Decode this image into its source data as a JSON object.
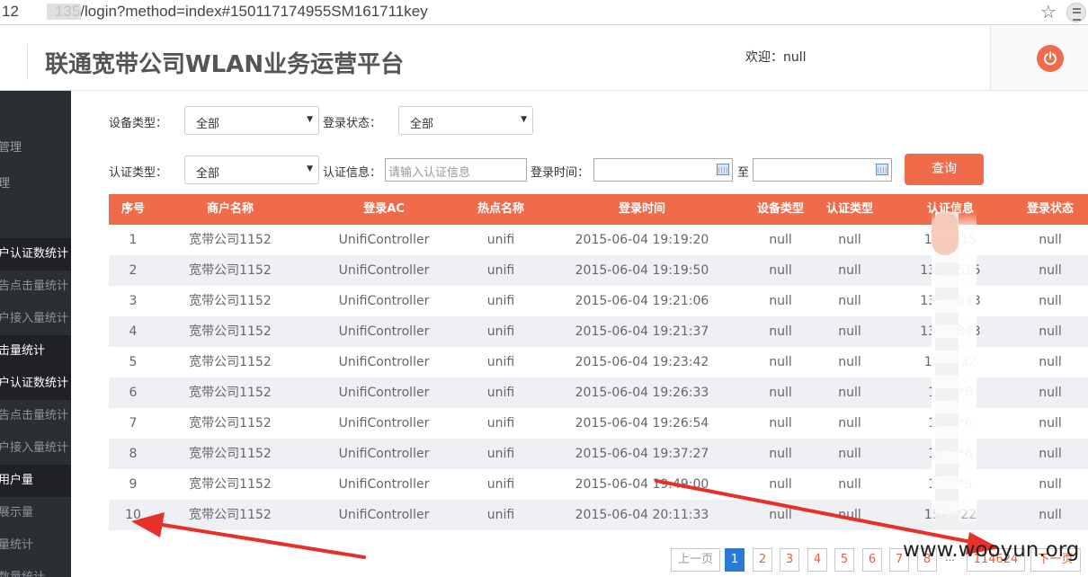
{
  "browser": {
    "url_start": "12",
    "url_rest": "135/login?method=index#150117174955SM161711key"
  },
  "header": {
    "title": "联通宽带公司WLAN业务运营平台",
    "welcome": "欢迎：null"
  },
  "sidebar": {
    "items": [
      {
        "label": "管理",
        "kind": "top"
      },
      {
        "label": "理",
        "kind": "top"
      },
      {
        "label": "户认证数统计",
        "kind": "head"
      },
      {
        "label": "告点击量统计",
        "kind": "sub"
      },
      {
        "label": "户接入量统计",
        "kind": "sub"
      },
      {
        "label": "击量统计",
        "kind": "head"
      },
      {
        "label": "户认证数统计",
        "kind": "head"
      },
      {
        "label": "告点击量统计",
        "kind": "sub"
      },
      {
        "label": "户接入量统计",
        "kind": "sub"
      },
      {
        "label": "用户量",
        "kind": "head"
      },
      {
        "label": "展示量",
        "kind": "sub"
      },
      {
        "label": "量统计",
        "kind": "sub"
      },
      {
        "label": "数量统计",
        "kind": "sub"
      }
    ]
  },
  "filters": {
    "device_type_label": "设备类型：",
    "device_type_value": "全部",
    "login_status_label": "登录状态：",
    "login_status_value": "全部",
    "auth_type_label": "认证类型：",
    "auth_type_value": "全部",
    "auth_info_label": "认证信息：",
    "auth_info_placeholder": "请输入认证信息",
    "login_time_label": "登录时间：",
    "to_label": "至",
    "query_label": "查询"
  },
  "table": {
    "headers": [
      "序号",
      "商户名称",
      "登录AC",
      "热点名称",
      "登录时间",
      "设备类型",
      "认证类型",
      "认证信息",
      "登录状态"
    ],
    "rows": [
      [
        "1",
        "宽带公司1152",
        "UnifiController",
        "unifi",
        "2015-06-04 19:19:20",
        "null",
        "null",
        "13**515",
        "null"
      ],
      [
        "2",
        "宽带公司1152",
        "UnifiController",
        "unifi",
        "2015-06-04 19:19:50",
        "null",
        "null",
        "138**515",
        "null"
      ],
      [
        "3",
        "宽带公司1152",
        "UnifiController",
        "unifi",
        "2015-06-04 19:21:06",
        "null",
        "null",
        "138**843",
        "null"
      ],
      [
        "4",
        "宽带公司1152",
        "UnifiController",
        "unifi",
        "2015-06-04 19:21:37",
        "null",
        "null",
        "138**843",
        "null"
      ],
      [
        "5",
        "宽带公司1152",
        "UnifiController",
        "unifi",
        "2015-06-04 19:23:42",
        "null",
        "null",
        "187**32",
        "null"
      ],
      [
        "6",
        "宽带公司1152",
        "UnifiController",
        "unifi",
        "2015-06-04 19:26:33",
        "null",
        "null",
        "135**6",
        "null"
      ],
      [
        "7",
        "宽带公司1152",
        "UnifiController",
        "unifi",
        "2015-06-04 19:26:54",
        "null",
        "null",
        "184**6",
        "null"
      ],
      [
        "8",
        "宽带公司1152",
        "UnifiController",
        "unifi",
        "2015-06-04 19:37:27",
        "null",
        "null",
        "187**6",
        "null"
      ],
      [
        "9",
        "宽带公司1152",
        "UnifiController",
        "unifi",
        "2015-06-04 19:49:00",
        "null",
        "null",
        "189**9",
        "null"
      ],
      [
        "10",
        "宽带公司1152",
        "UnifiController",
        "unifi",
        "2015-06-04 20:11:33",
        "null",
        "null",
        "157**22",
        "null"
      ]
    ]
  },
  "pagination": {
    "prev": "上一页",
    "pages": [
      "1",
      "2",
      "3",
      "4",
      "5",
      "6",
      "7",
      "8"
    ],
    "ellipsis": "...",
    "last": "114624",
    "next": "下一页",
    "active": "1"
  },
  "watermark": "www.wooyun.org",
  "colors": {
    "accent": "#ef6b4a",
    "sidebar_bg": "#2b2e33",
    "active_page": "#2b7bd6",
    "annotation_arrow": "#e8302a"
  }
}
